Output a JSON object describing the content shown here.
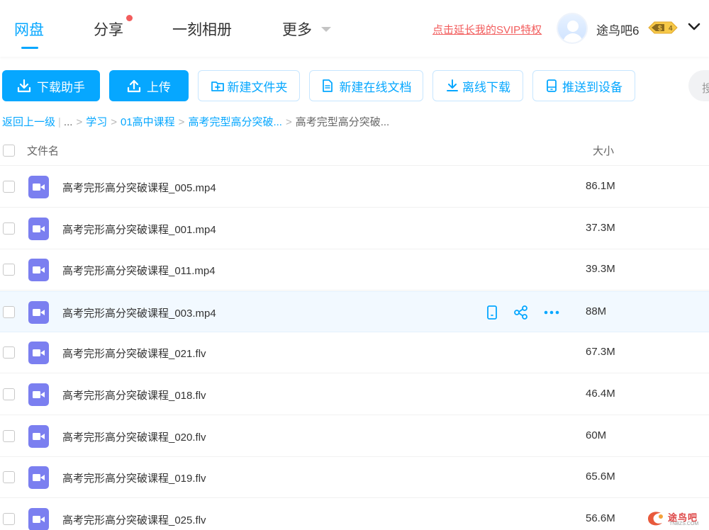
{
  "nav": {
    "tabs": [
      "网盘",
      "分享",
      "一刻相册",
      "更多"
    ],
    "svip_link": "点击延长我的SVIP特权",
    "username": "途鸟吧6",
    "vip_level": "4",
    "accent": "#06a7ff"
  },
  "toolbar": {
    "download_helper": "下载助手",
    "upload": "上传",
    "new_folder": "新建文件夹",
    "new_online_doc": "新建在线文档",
    "offline_download": "离线下载",
    "push_to_device": "推送到设备",
    "search_stub": "搜"
  },
  "breadcrumb": {
    "back": "返回上一级",
    "ellipsis": "...",
    "items": [
      "学习",
      "01高中课程",
      "高考完型高分突破..."
    ],
    "current": "高考完型高分突破..."
  },
  "list": {
    "col_name": "文件名",
    "col_size": "大小",
    "rows": [
      {
        "name": "高考完形高分突破课程_005.mp4",
        "size": "86.1M"
      },
      {
        "name": "高考完形高分突破课程_001.mp4",
        "size": "37.3M"
      },
      {
        "name": "高考完形高分突破课程_011.mp4",
        "size": "39.3M"
      },
      {
        "name": "高考完形高分突破课程_003.mp4",
        "size": "88M"
      },
      {
        "name": "高考完形高分突破课程_021.flv",
        "size": "67.3M"
      },
      {
        "name": "高考完形高分突破课程_018.flv",
        "size": "46.4M"
      },
      {
        "name": "高考完形高分突破课程_020.flv",
        "size": "60M"
      },
      {
        "name": "高考完形高分突破课程_019.flv",
        "size": "65.6M"
      },
      {
        "name": "高考完形高分突破课程_025.flv",
        "size": "56.6M"
      }
    ],
    "hovered_row": 3,
    "file_icon_color": "#7b7ff0"
  },
  "watermark": {
    "text": "途鸟吧",
    "sub": "TNBZS.COM"
  }
}
